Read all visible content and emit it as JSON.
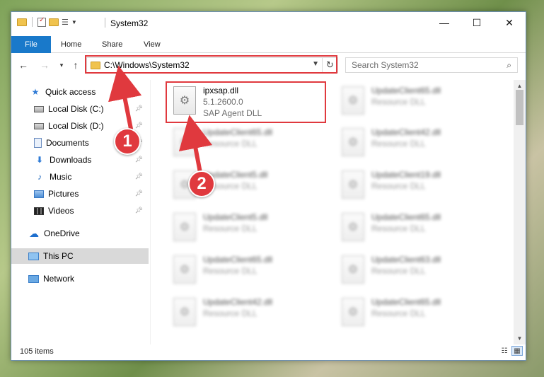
{
  "window": {
    "title": "System32",
    "minimize_glyph": "—",
    "maximize_glyph": "☐",
    "close_glyph": "✕"
  },
  "ribbon": {
    "tabs": [
      {
        "label": "File"
      },
      {
        "label": "Home"
      },
      {
        "label": "Share"
      },
      {
        "label": "View"
      }
    ]
  },
  "address": {
    "path": "C:\\Windows\\System32"
  },
  "search": {
    "placeholder": "Search System32"
  },
  "sidebar": {
    "items": [
      {
        "label": "Quick access",
        "icon": "star-icon"
      },
      {
        "label": "Local Disk (C:)",
        "icon": "disk-icon",
        "pinned": true
      },
      {
        "label": "Local Disk (D:)",
        "icon": "disk-icon",
        "pinned": true
      },
      {
        "label": "Documents",
        "icon": "documents-icon",
        "pinned": true
      },
      {
        "label": "Downloads",
        "icon": "download-icon",
        "pinned": true
      },
      {
        "label": "Music",
        "icon": "music-icon",
        "pinned": true
      },
      {
        "label": "Pictures",
        "icon": "pictures-icon",
        "pinned": true
      },
      {
        "label": "Videos",
        "icon": "videos-icon",
        "pinned": true
      },
      {
        "label": "OneDrive",
        "icon": "cloud-icon"
      },
      {
        "label": "This PC",
        "icon": "pc-icon",
        "selected": true
      },
      {
        "label": "Network",
        "icon": "network-icon"
      }
    ]
  },
  "files": {
    "featured": {
      "name": "ipxsap.dll",
      "version": "5.1.2600.0",
      "description": "SAP Agent DLL"
    },
    "left_column": [
      {
        "name": "UpdateClient65.dll",
        "type": "Resource DLL"
      },
      {
        "name": "UpdateClient5.dll",
        "type": "Resource DLL"
      },
      {
        "name": "UpdateClient5.dll",
        "type": "Resource DLL"
      },
      {
        "name": "UpdateClient65.dll",
        "type": "Resource DLL"
      },
      {
        "name": "UpdateClient42.dll",
        "type": "Resource DLL"
      }
    ],
    "right_column": [
      {
        "name": "UpdateClient65.dll",
        "type": "Resource DLL"
      },
      {
        "name": "UpdateClient42.dll",
        "type": "Resource DLL"
      },
      {
        "name": "UpdateClient19.dll",
        "type": "Resource DLL"
      },
      {
        "name": "UpdateClient65.dll",
        "type": "Resource DLL"
      },
      {
        "name": "UpdateClient63.dll",
        "type": "Resource DLL"
      },
      {
        "name": "UpdateClient65.dll",
        "type": "Resource DLL"
      }
    ]
  },
  "status": {
    "item_count": "105 items"
  },
  "annotations": {
    "step1": "1",
    "step2": "2",
    "color": "#e0393e"
  }
}
